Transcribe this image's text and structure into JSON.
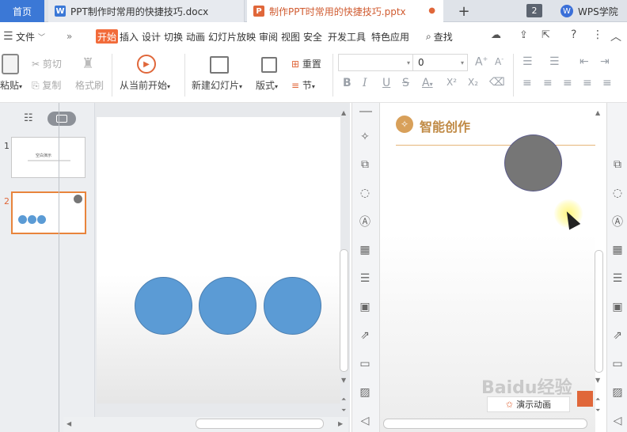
{
  "titlebar": {
    "home_tab": "首页",
    "doc_tab": "PPT制作时常用的快捷技巧.docx",
    "ppt_tab": "制作PPT时常用的快捷技巧.pptx",
    "new_tab": "+",
    "window_count": "2",
    "wps_academy": "WPS学院"
  },
  "menu": {
    "file": "文件",
    "more": "»",
    "items": [
      "开始",
      "插入",
      "设计",
      "切换",
      "动画",
      "幻灯片放映",
      "审阅",
      "视图",
      "安全",
      "开发工具",
      "特色应用"
    ],
    "search": "查找",
    "help": "?"
  },
  "toolbar": {
    "paste": "粘贴",
    "cut": "剪切",
    "copy": "复制",
    "format_painter": "格式刷",
    "play_from_current": "从当前开始",
    "new_slide": "新建幻灯片",
    "layout": "版式",
    "reset": "重置",
    "section": "节",
    "font_name": "",
    "font_size": "0",
    "font_grow": "A",
    "font_shrink": "A",
    "bold": "B",
    "italic": "I",
    "underline": "U",
    "strike": "S",
    "font_color": "A",
    "superscript": "X²",
    "subscript": "X₂"
  },
  "slides_panel": {
    "thumb1_number": "1",
    "thumb1_text": "空白演示",
    "thumb2_number": "2"
  },
  "smart_pane": {
    "title": "智能创作",
    "close": "×",
    "animation_button": "演示动画"
  },
  "watermark": "Baidu经验",
  "colors": {
    "accent": "#f26b3a",
    "circle_blue": "#5b9bd5",
    "circle_gray": "#767676",
    "home_tab": "#3b78d6",
    "selected_thumb_border": "#e8843c"
  }
}
